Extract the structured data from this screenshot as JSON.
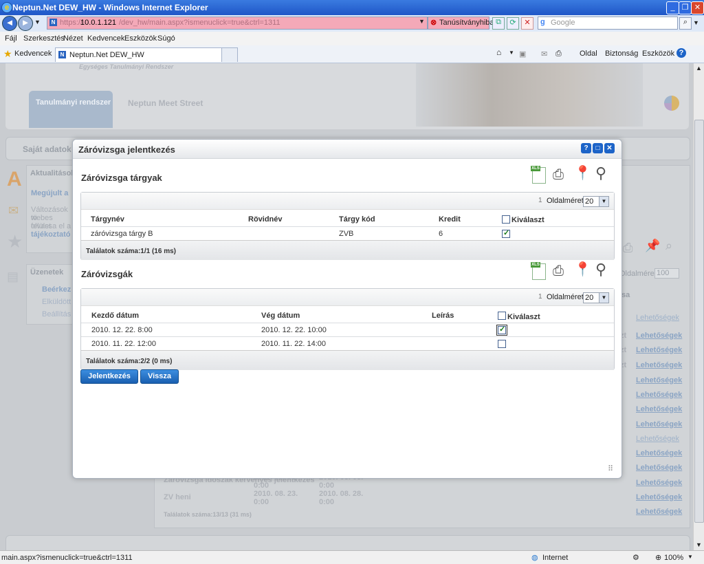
{
  "window": {
    "title": "Neptun.Net DEW_HW - Windows Internet Explorer"
  },
  "address": {
    "url_main": "10.0.1.121",
    "url_rest": "/dev_hw/main.aspx?ismenuclick=true&ctrl=1311",
    "url_prefix": "https://",
    "cert": "Tanúsítványhiba",
    "search_placeholder": "Google"
  },
  "menu": [
    "Fájl",
    "Szerkesztés",
    "Nézet",
    "Kedvencek",
    "Eszközök",
    "Súgó"
  ],
  "favorites": {
    "label": "Kedvencek",
    "tab_title": "Neptun.Net DEW_HW"
  },
  "commandbar": {
    "page": "Oldal",
    "security": "Biztonság",
    "tools": "Eszközök"
  },
  "background": {
    "tagline": "Egységes Tanulmányi Rendszer",
    "tab_active": "Tanulmányi rendszer",
    "tab_inactive": "Neptun Meet Street",
    "nav_first": "Saját adatok",
    "box1_title": "Aktualitások",
    "box1_link": "Megújult a",
    "box1_text": [
      "Változások tö",
      "webes felület",
      "olvassa el a",
      "tájékoztató"
    ],
    "box2_title": "Üzenetek",
    "box2_items": [
      "Beérkez",
      "Elküldött",
      "Beállítás"
    ],
    "right_labels": [
      "Oldalméret",
      "100",
      "sa"
    ],
    "links": [
      "Lehetőségek",
      "Lehetőségek",
      "Lehetőségek",
      "Lehetőségek",
      "Lehetőségek",
      "Lehetőségek",
      "Lehetőségek",
      "Lehetőségek",
      "Lehetőségek",
      "Lehetőségek",
      "Lehetőségek",
      "Lehetőségek",
      "Lehetőségek",
      "Lehetőségek"
    ],
    "link_prefix": "zt",
    "rows": [
      {
        "name": "Záróvizsga időszak kérvényes jelentkezés",
        "start": "2010. 08. 01. 0:00",
        "end": "2010. 08. 08. 0:00"
      },
      {
        "name": "ZV heni",
        "start": "2010. 08. 23. 0:00",
        "end": "2010. 08. 28. 0:00"
      }
    ],
    "footer": "Találatok száma:13/13 (31 ms)"
  },
  "modal": {
    "title": "Záróvizsga jelentkezés",
    "section1": {
      "title": "Záróvizsga tárgyak",
      "page_index": "1",
      "page_size_label": "Oldalméret",
      "page_size": "20",
      "columns": [
        "Tárgynév",
        "Rövidnév",
        "Tárgy kód",
        "Kredit",
        "Kiválaszt"
      ],
      "rows": [
        {
          "name": "záróvizsga tárgy B",
          "short": "",
          "code": "ZVB",
          "credit": "6",
          "selected": true
        }
      ],
      "footer": "Találatok száma:1/1 (16 ms)"
    },
    "section2": {
      "title": "Záróvizsgák",
      "page_index": "1",
      "page_size_label": "Oldalméret",
      "page_size": "20",
      "columns": [
        "Kezdő dátum",
        "Vég dátum",
        "Leírás",
        "Kiválaszt"
      ],
      "rows": [
        {
          "start": "2010. 12. 22. 8:00",
          "end": "2010. 12. 22. 10:00",
          "desc": "",
          "selected": true
        },
        {
          "start": "2010. 11. 22. 12:00",
          "end": "2010. 11. 22. 14:00",
          "desc": "",
          "selected": false
        }
      ],
      "footer": "Találatok száma:2/2 (0 ms)"
    },
    "buttons": {
      "submit": "Jelentkezés",
      "back": "Vissza"
    }
  },
  "status": {
    "url": "main.aspx?ismenuclick=true&ctrl=1311",
    "zone": "Internet",
    "zoom": "100%"
  },
  "colors": {
    "title_blue": "#1f56c7",
    "address_error": "#f4a9b8",
    "button_blue": "#1a5fb0",
    "link_blue": "#1d64c8"
  }
}
